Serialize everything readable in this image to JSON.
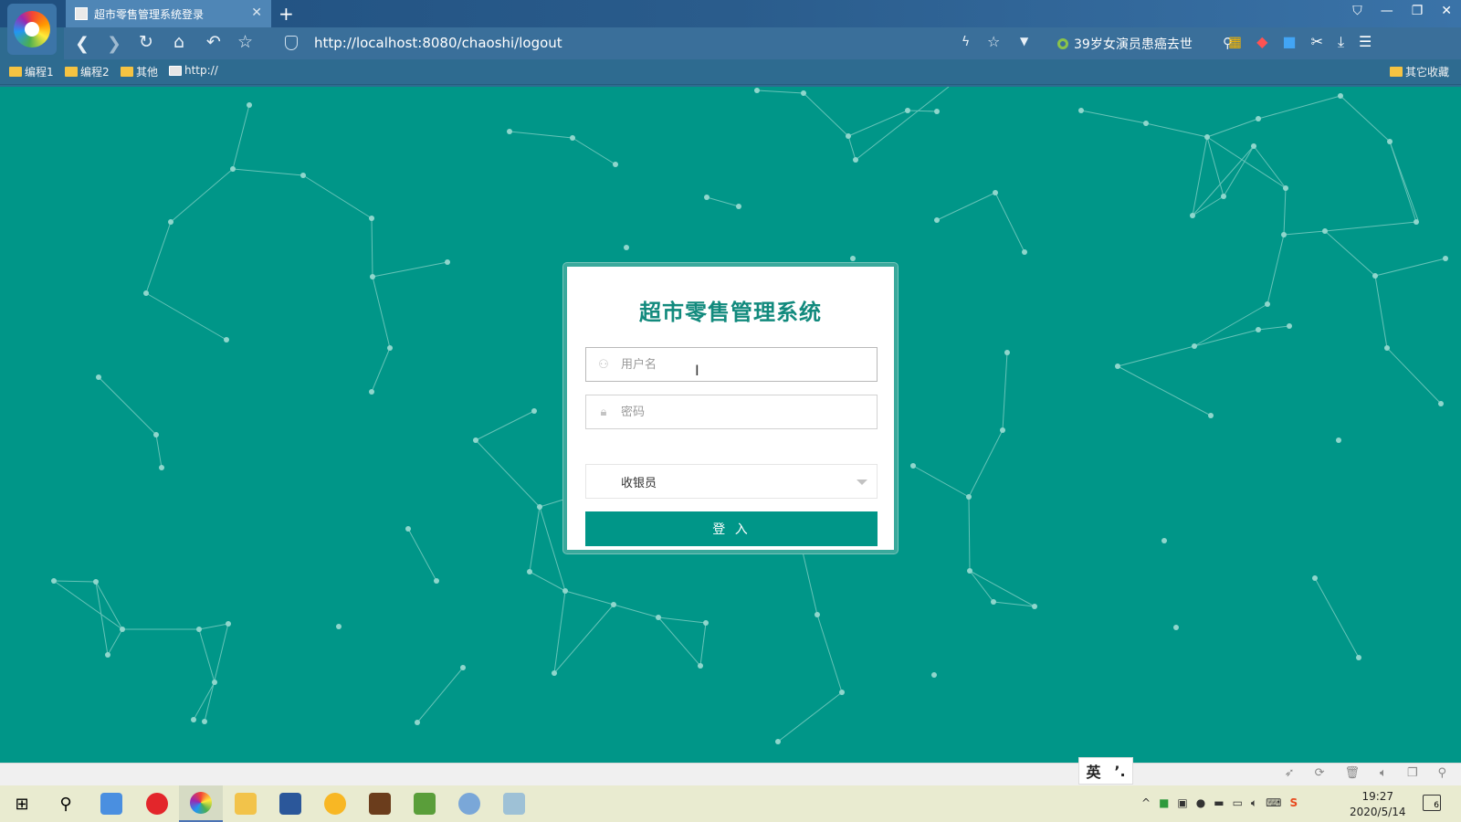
{
  "browser": {
    "tab_title": "超市零售管理系统登录",
    "tab_close": "✕",
    "new_tab": "+",
    "url": "http://localhost:8080/chaoshi/logout",
    "news_headline": "39岁女演员患癌去世",
    "window_buttons": [
      "⛉",
      "—",
      "❐",
      "✕"
    ],
    "bookmarks": [
      {
        "label": "编程1",
        "type": "folder"
      },
      {
        "label": "编程2",
        "type": "folder"
      },
      {
        "label": "其他",
        "type": "folder"
      },
      {
        "label": "http://",
        "type": "page"
      }
    ],
    "other_bookmarks": "其它收藏"
  },
  "login": {
    "title": "超市零售管理系统",
    "username_placeholder": "用户名",
    "password_placeholder": "密码",
    "role_selected": "收银员",
    "submit_label": "登 入"
  },
  "ime": {
    "lang": "英",
    "punct": "’."
  },
  "clock": {
    "time": "19:27",
    "date": "2020/5/14"
  },
  "notifications": {
    "count": "6"
  },
  "colors": {
    "accent": "#009688",
    "title": "#128a7d",
    "chrome": "#2e6b90"
  }
}
